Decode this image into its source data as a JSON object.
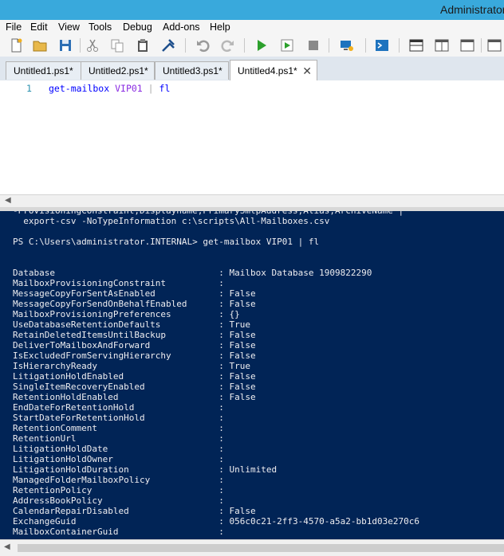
{
  "window": {
    "title": "Administrator"
  },
  "menu": [
    "File",
    "Edit",
    "View",
    "Tools",
    "Debug",
    "Add-ons",
    "Help"
  ],
  "toolbar": {
    "icons": [
      "new-file-icon",
      "open-folder-icon",
      "save-icon",
      "cut-icon",
      "copy-icon",
      "paste-icon",
      "clear-icon",
      "undo-icon",
      "redo-icon",
      "run-icon",
      "run-selection-icon",
      "stop-icon",
      "remote-powershell-icon",
      "powershell-console-icon",
      "show-script-top-icon",
      "show-script-right-icon",
      "show-script-maximized-icon",
      "show-commands-icon"
    ],
    "accent": "#1e73be"
  },
  "tabs": [
    {
      "label": "Untitled1.ps1*",
      "active": false
    },
    {
      "label": "Untitled2.ps1*",
      "active": false
    },
    {
      "label": "Untitled3.ps1*",
      "active": false
    },
    {
      "label": "Untitled4.ps1*",
      "active": true
    }
  ],
  "editor": {
    "line_number": "1",
    "cmdlet": "get-mailbox",
    "argument": "VIP01",
    "pipe": "|",
    "format": "fl"
  },
  "console": {
    "background": "#012456",
    "partial_top": "-ProvisioningConstraint,Displayname,PrimarySmtpAddress,Alias,ArchiveName |",
    "export_line": "  export-csv -NoTypeInformation c:\\scripts\\All-Mailboxes.csv",
    "prompt": "PS C:\\Users\\administrator.INTERNAL> get-mailbox VIP01 | fl",
    "properties": [
      {
        "name": "Database",
        "value": "Mailbox Database 1909822290"
      },
      {
        "name": "MailboxProvisioningConstraint",
        "value": ""
      },
      {
        "name": "MessageCopyForSentAsEnabled",
        "value": "False"
      },
      {
        "name": "MessageCopyForSendOnBehalfEnabled",
        "value": "False"
      },
      {
        "name": "MailboxProvisioningPreferences",
        "value": "{}"
      },
      {
        "name": "UseDatabaseRetentionDefaults",
        "value": "True"
      },
      {
        "name": "RetainDeletedItemsUntilBackup",
        "value": "False"
      },
      {
        "name": "DeliverToMailboxAndForward",
        "value": "False"
      },
      {
        "name": "IsExcludedFromServingHierarchy",
        "value": "False"
      },
      {
        "name": "IsHierarchyReady",
        "value": "True"
      },
      {
        "name": "LitigationHoldEnabled",
        "value": "False"
      },
      {
        "name": "SingleItemRecoveryEnabled",
        "value": "False"
      },
      {
        "name": "RetentionHoldEnabled",
        "value": "False"
      },
      {
        "name": "EndDateForRetentionHold",
        "value": ""
      },
      {
        "name": "StartDateForRetentionHold",
        "value": ""
      },
      {
        "name": "RetentionComment",
        "value": ""
      },
      {
        "name": "RetentionUrl",
        "value": ""
      },
      {
        "name": "LitigationHoldDate",
        "value": ""
      },
      {
        "name": "LitigationHoldOwner",
        "value": ""
      },
      {
        "name": "LitigationHoldDuration",
        "value": "Unlimited"
      },
      {
        "name": "ManagedFolderMailboxPolicy",
        "value": ""
      },
      {
        "name": "RetentionPolicy",
        "value": ""
      },
      {
        "name": "AddressBookPolicy",
        "value": ""
      },
      {
        "name": "CalendarRepairDisabled",
        "value": "False"
      },
      {
        "name": "ExchangeGuid",
        "value": "056c0c21-2ff3-4570-a5a2-bb1d03e270c6"
      },
      {
        "name": "MailboxContainerGuid",
        "value": ""
      }
    ]
  }
}
